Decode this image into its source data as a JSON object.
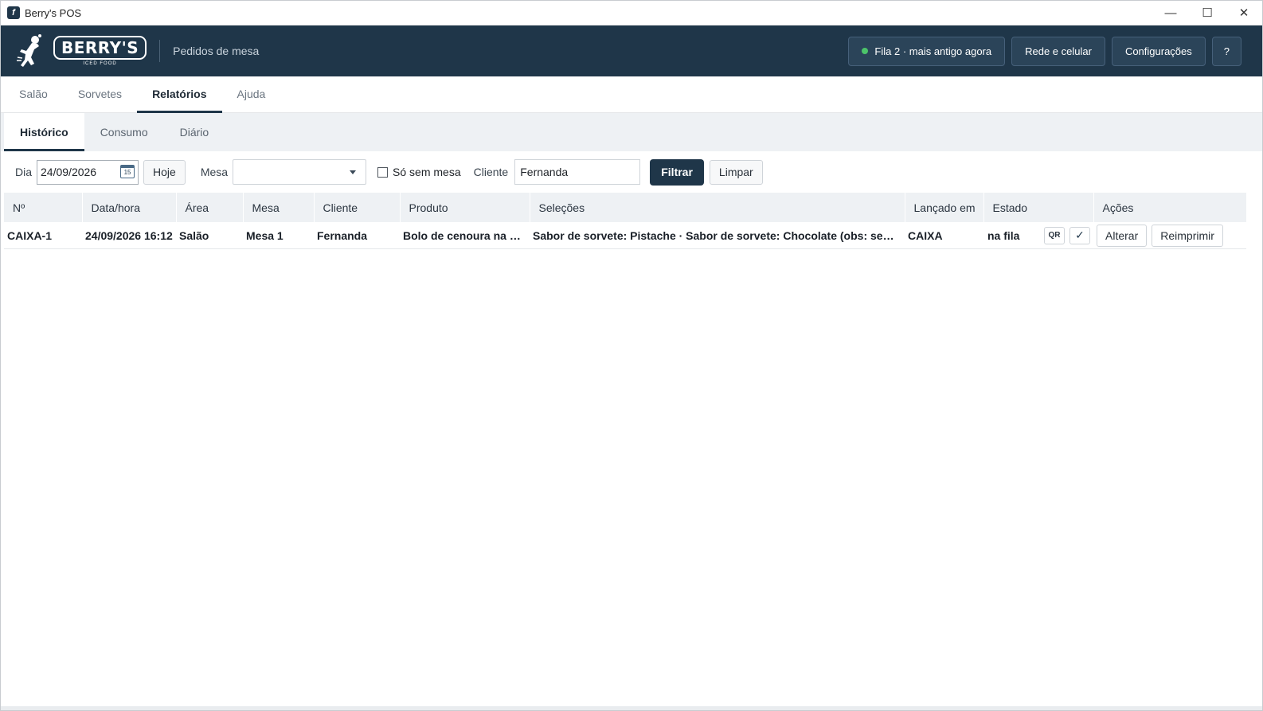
{
  "window": {
    "title": "Berry's POS",
    "controls": [
      "—",
      "☐",
      "✕"
    ]
  },
  "header": {
    "brand": "BERRY'S",
    "brand_sub": "ICED FOOD",
    "subtitle": "Pedidos de mesa",
    "status_label": "Fila 2 · mais antigo agora",
    "status_color": "#4cc46a",
    "network_label": "Rede e celular",
    "settings_label": "Configurações",
    "help_label": "?",
    "bg_color": "#1f3649"
  },
  "main_tabs": [
    {
      "label": "Salão",
      "active": false
    },
    {
      "label": "Sorvetes",
      "active": false
    },
    {
      "label": "Relatórios",
      "active": true
    },
    {
      "label": "Ajuda",
      "active": false
    }
  ],
  "sub_tabs": [
    {
      "label": "Histórico",
      "active": true
    },
    {
      "label": "Consumo",
      "active": false
    },
    {
      "label": "Diário",
      "active": false
    }
  ],
  "filters": {
    "day_label": "Dia",
    "day_value": "24/09/2026",
    "calendar_glyph": "15",
    "today_label": "Hoje",
    "table_label": "Mesa",
    "table_value": "",
    "no_table_label": "Só sem mesa",
    "no_table_checked": false,
    "client_label": "Cliente",
    "client_value": "Fernanda",
    "filter_label": "Filtrar",
    "clear_label": "Limpar"
  },
  "table": {
    "columns": [
      "Nº",
      "Data/hora",
      "Área",
      "Mesa",
      "Cliente",
      "Produto",
      "Seleções",
      "Lançado em",
      "Estado",
      "Ações"
    ],
    "rows": [
      {
        "num": "CAIXA-1",
        "datetime": "24/09/2026 16:12",
        "area": "Salão",
        "mesa": "Mesa 1",
        "cliente": "Fernanda",
        "produto": "Bolo de cenoura na cha...",
        "selecoes": "Sabor de sorvete: Pistache · Sabor de sorvete: Chocolate (obs: sem calda)",
        "lancado": "CAIXA",
        "estado": "na fila",
        "qr_label": "QR",
        "check_label": "✓",
        "edit_label": "Alterar",
        "reprint_label": "Reimprimir"
      }
    ]
  }
}
